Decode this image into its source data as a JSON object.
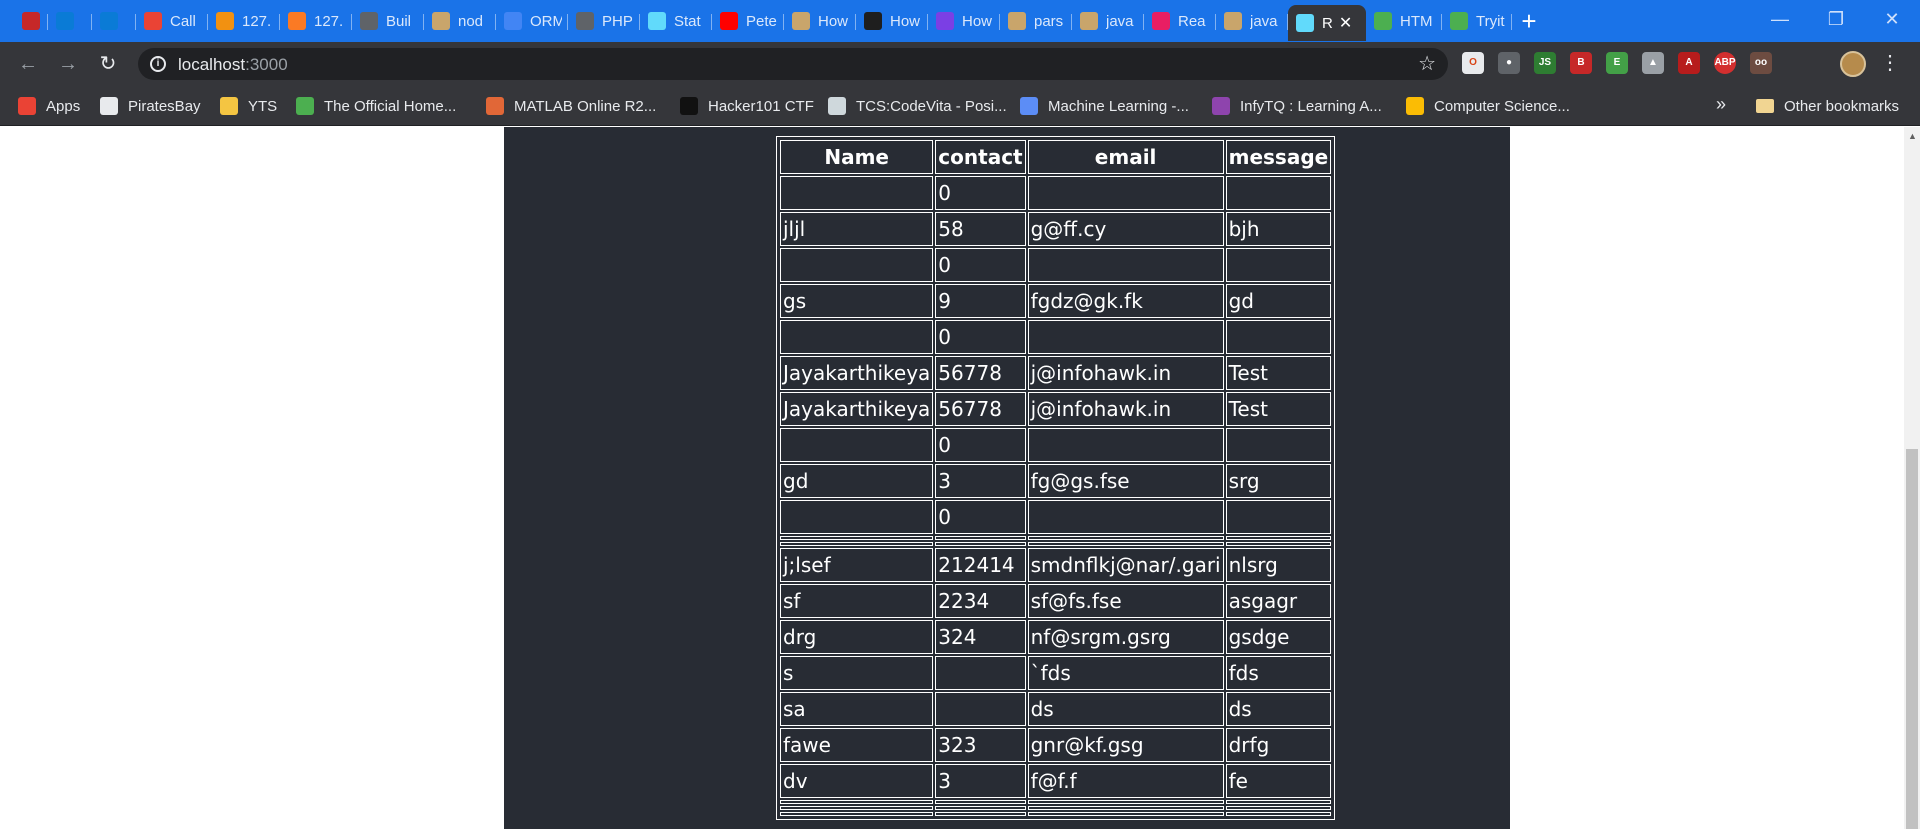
{
  "browser": {
    "tabs": [
      {
        "title": "",
        "icon": "mosaic-icon",
        "color": "#c62828"
      },
      {
        "title": "",
        "icon": "k-icon",
        "color": "#0a7bd6"
      },
      {
        "title": "",
        "icon": "k-icon",
        "color": "#0a7bd6"
      },
      {
        "title": "Call",
        "icon": "gmail-icon",
        "color": "#ea4335"
      },
      {
        "title": "127.",
        "icon": "mysql-icon",
        "color": "#f29111"
      },
      {
        "title": "127.",
        "icon": "xampp-icon",
        "color": "#fb7a24"
      },
      {
        "title": "Buil",
        "icon": "page-icon",
        "color": "#5f6368"
      },
      {
        "title": "nod",
        "icon": "doc-icon",
        "color": "#c9a56b"
      },
      {
        "title": "ORM",
        "icon": "google-icon",
        "color": "#4285f4"
      },
      {
        "title": "PHP",
        "icon": "chart-icon",
        "color": "#5f6368"
      },
      {
        "title": "Stat",
        "icon": "react-icon",
        "color": "#61dafb"
      },
      {
        "title": "Pete",
        "icon": "youtube-icon",
        "color": "#ff0000"
      },
      {
        "title": "How",
        "icon": "doc-icon",
        "color": "#c9a56b"
      },
      {
        "title": "How",
        "icon": "hackernoon-icon",
        "color": "#1e1e1e"
      },
      {
        "title": "How",
        "icon": "rocket-icon",
        "color": "#7b3fe4"
      },
      {
        "title": "pars",
        "icon": "doc-icon",
        "color": "#c9a56b"
      },
      {
        "title": "java",
        "icon": "doc-icon",
        "color": "#c9a56b"
      },
      {
        "title": "Rea",
        "icon": "graph-icon",
        "color": "#e91e63"
      },
      {
        "title": "java",
        "icon": "doc-icon",
        "color": "#c9a56b"
      },
      {
        "title": "R",
        "icon": "react-icon",
        "color": "#61dafb",
        "active": true
      },
      {
        "title": "HTM",
        "icon": "w3schools-icon",
        "color": "#4caf50"
      },
      {
        "title": "Tryit",
        "icon": "w3schools-icon",
        "color": "#4caf50"
      }
    ],
    "new_tab": "+",
    "address": {
      "host": "localhost",
      "port": ":3000"
    },
    "bookmarks": [
      {
        "label": "Apps",
        "icon": "apps-grid-icon",
        "color": "#ea4335"
      },
      {
        "label": "PiratesBay",
        "icon": "monitor-icon",
        "color": "#e8eaed"
      },
      {
        "label": "YTS",
        "icon": "envelope-icon",
        "color": "#f4c542"
      },
      {
        "label": "The Official Home...",
        "icon": "leaf-icon",
        "color": "#4caf50"
      },
      {
        "label": "MATLAB Online R2...",
        "icon": "matlab-icon",
        "color": "#e16737"
      },
      {
        "label": "Hacker101 CTF",
        "icon": "hacker-icon",
        "color": "#111111"
      },
      {
        "label": "TCS:CodeVita - Posi...",
        "icon": "tcs-icon",
        "color": "#cfd8dc"
      },
      {
        "label": "Machine Learning -...",
        "icon": "infinity-icon",
        "color": "#5c8df6"
      },
      {
        "label": "InfyTQ : Learning A...",
        "icon": "infy-icon",
        "color": "#8e44ad"
      },
      {
        "label": "Computer Science...",
        "icon": "drive-icon",
        "color": "#fbbc04"
      }
    ],
    "other_bookmarks": "Other bookmarks",
    "overflow": "»"
  },
  "table": {
    "headers": [
      "Name",
      "contact",
      "email",
      "message"
    ],
    "rows": [
      [
        "",
        "0",
        "",
        ""
      ],
      [
        "jljl",
        "58",
        "g@ff.cy",
        "bjh"
      ],
      [
        "",
        "0",
        "",
        ""
      ],
      [
        "gs",
        "9",
        "fgdz@gk.fk",
        "gd"
      ],
      [
        "",
        "0",
        "",
        ""
      ],
      [
        "Jayakarthikeya",
        "56778",
        "j@infohawk.in",
        "Test"
      ],
      [
        "Jayakarthikeya",
        "56778",
        "j@infohawk.in",
        "Test"
      ],
      [
        "",
        "0",
        "",
        ""
      ],
      [
        "gd",
        "3",
        "fg@gs.fse",
        "srg"
      ],
      [
        "",
        "0",
        "",
        ""
      ],
      [
        "",
        "",
        "",
        ""
      ],
      [
        "",
        "",
        "",
        ""
      ],
      [
        "j;lsef",
        "212414",
        "smdnflkj@nar/.gari",
        "nlsrg"
      ],
      [
        "sf",
        "2234",
        "sf@fs.fse",
        "asgagr"
      ],
      [
        "drg",
        "324",
        "nf@srgm.gsrg",
        "gsdge"
      ],
      [
        "s",
        "",
        "`fds",
        "fds"
      ],
      [
        "sa",
        "",
        "ds",
        "ds"
      ],
      [
        "fawe",
        "323",
        "gnr@kf.gsg",
        "drfg"
      ],
      [
        "dv",
        "3",
        "f@f.f",
        "fe"
      ],
      [
        "",
        "",
        "",
        ""
      ],
      [
        "",
        "",
        "",
        ""
      ],
      [
        "",
        "",
        "",
        ""
      ]
    ]
  }
}
